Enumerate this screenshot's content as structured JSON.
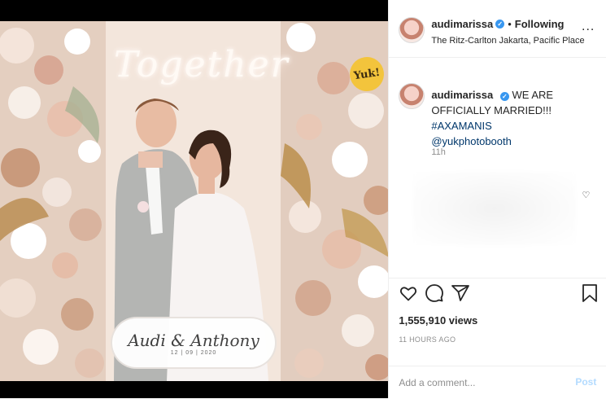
{
  "photo": {
    "neon_text": "Together",
    "badge_text": "Yuk!",
    "name_card": {
      "names": "Audi & Anthony",
      "date": "12 | 09 | 2020"
    }
  },
  "header": {
    "username": "audimarissa",
    "verified_icon": "verified-badge-icon",
    "separator": "•",
    "follow_status": "Following",
    "location": "The Ritz-Carlton Jakarta, Pacific Place",
    "more_icon": "ellipsis-icon",
    "more_glyph": "..."
  },
  "caption": {
    "username": "audimarissa",
    "text": "WE ARE OFFICIALLY MARRIED!!! ",
    "hashtag": "#AXAMANIS",
    "mention": "@yukphotobooth",
    "time": "11h"
  },
  "actions": {
    "icons": [
      "heart-icon",
      "comment-icon",
      "share-icon",
      "bookmark-icon"
    ],
    "likes": "1,555,910 views",
    "posted": "11 HOURS AGO"
  },
  "comment_box": {
    "placeholder": "Add a comment...",
    "post_label": "Post"
  },
  "colors": {
    "link": "#00376b",
    "verified": "#3897f0",
    "post_disabled": "#b3dbff",
    "muted": "#8e8e8e"
  }
}
